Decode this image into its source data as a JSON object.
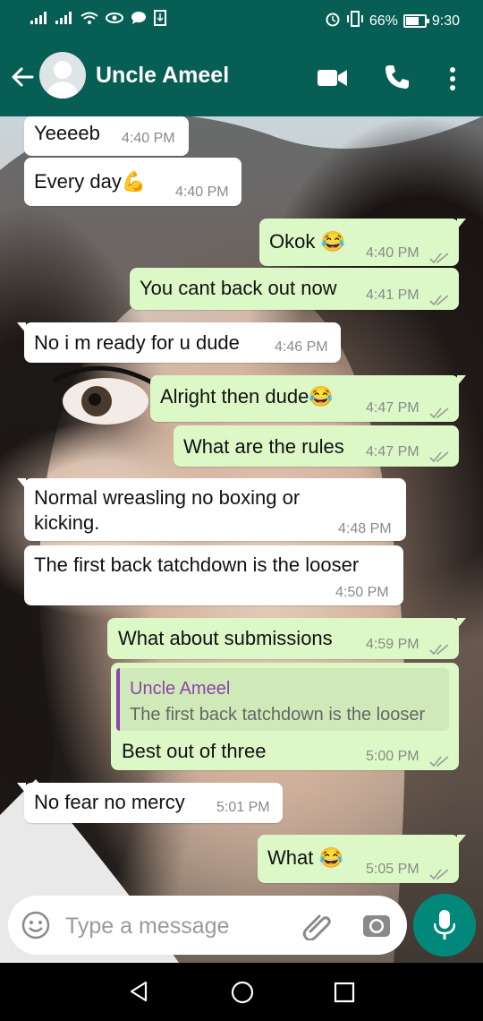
{
  "status_bar": {
    "left_text": "E  H⁺",
    "battery_percent": "66%",
    "time": "9:30"
  },
  "header": {
    "contact_name": "Uncle Ameel",
    "icons": [
      "back-arrow-icon",
      "avatar",
      "video-call-icon",
      "phone-icon",
      "more-vert-icon"
    ]
  },
  "messages": [
    {
      "direction": "in",
      "text": "Yeeeeb",
      "time": "4:40 PM"
    },
    {
      "direction": "in",
      "text": "Every day💪",
      "time": "4:40 PM"
    },
    {
      "direction": "out",
      "text": "Okok 😂",
      "time": "4:40 PM",
      "status": "read"
    },
    {
      "direction": "out",
      "text": "You cant back out now",
      "time": "4:41 PM",
      "status": "read"
    },
    {
      "direction": "in",
      "text": "No i m ready for u dude",
      "time": "4:46 PM"
    },
    {
      "direction": "out",
      "text": "Alright then dude😂",
      "time": "4:47 PM",
      "status": "read"
    },
    {
      "direction": "out",
      "text": "What are the rules",
      "time": "4:47 PM",
      "status": "read"
    },
    {
      "direction": "in",
      "text_line1": "Normal wreasling no boxing or",
      "text_line2": "kicking.",
      "time": "4:48 PM"
    },
    {
      "direction": "in",
      "text": "The first back tatchdown is the looser",
      "time": "4:50 PM"
    },
    {
      "direction": "out",
      "text": "What about submissions",
      "time": "4:59 PM",
      "status": "read"
    },
    {
      "direction": "out",
      "quote_author": "Uncle Ameel",
      "quote_text": "The first back tatchdown is the looser",
      "text": "Best out of three",
      "time": "5:00 PM",
      "status": "read"
    },
    {
      "direction": "in",
      "text": "No fear no mercy",
      "time": "5:01 PM"
    },
    {
      "direction": "out",
      "text": "What 😂",
      "time": "5:05 PM",
      "status": "read"
    }
  ],
  "composer": {
    "placeholder": "Type a message"
  },
  "colors": {
    "header": "#075e54",
    "outgoing_bubble": "#dcf8c6",
    "incoming_bubble": "#ffffff",
    "mic_button": "#00897b",
    "quote_accent": "#8e44ad"
  }
}
